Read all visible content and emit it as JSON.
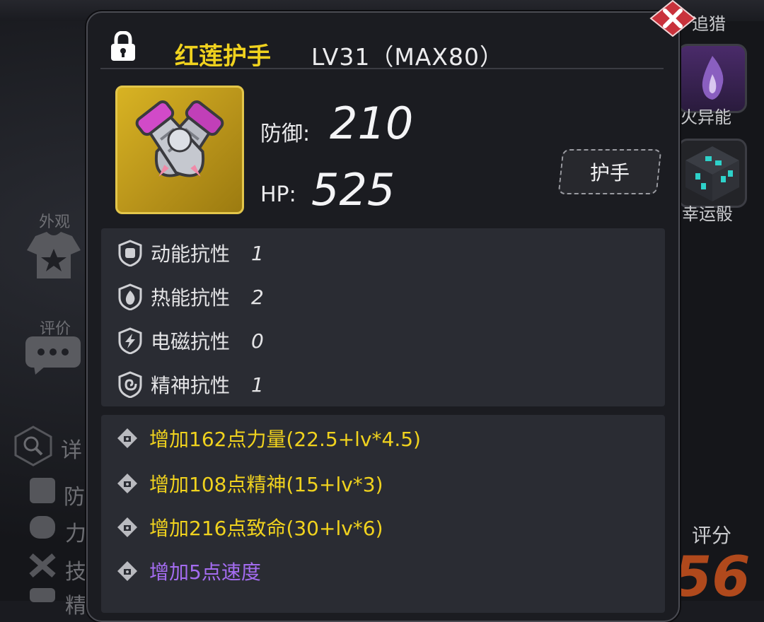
{
  "background": {
    "left": {
      "appearance_label": "外观",
      "review_label": "评价",
      "detail_label": "详",
      "side_stats": [
        "防",
        "力",
        "技",
        "精"
      ]
    },
    "right": {
      "hunt_label": "追猎",
      "fire_ability_label": "火异能",
      "lucky_dice_label": "幸运骰",
      "score_label": "评分",
      "score_value": "56"
    }
  },
  "panel": {
    "item_name": "红莲护手",
    "level_text": "LV31（MAX80）",
    "defense_label": "防御:",
    "defense_value": "210",
    "hp_label": "HP:",
    "hp_value": "525",
    "type_label": "护手",
    "resistances": [
      {
        "name": "动能抗性",
        "value": "1",
        "icon": "fist-shield-icon"
      },
      {
        "name": "热能抗性",
        "value": "2",
        "icon": "flame-shield-icon"
      },
      {
        "name": "电磁抗性",
        "value": "0",
        "icon": "lightning-shield-icon"
      },
      {
        "name": "精神抗性",
        "value": "1",
        "icon": "spiral-shield-icon"
      }
    ],
    "bonuses": [
      {
        "text": "增加162点力量(22.5+lv*4.5)",
        "color": "#f0d21e"
      },
      {
        "text": "增加108点精神(15+lv*3)",
        "color": "#f0d21e"
      },
      {
        "text": "增加216点致命(30+lv*6)",
        "color": "#f0d21e"
      },
      {
        "text": "增加5点速度",
        "color": "#a46cf0"
      }
    ]
  },
  "colors": {
    "title_gold": "#f0d21e",
    "close_red": "#c9323c",
    "panel_bg": "#1b1c21",
    "section_bg": "#2a2c33"
  }
}
